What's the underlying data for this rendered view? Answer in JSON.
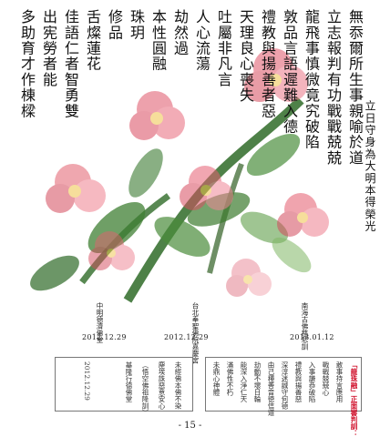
{
  "columns": [
    "無忝爾所生事親喻於道",
    "立志報判有功戰戰兢兢",
    "龍飛事慎微竟究破陷",
    "敦品言語遲難入德",
    "禮教與揚善者惡",
    "天理良心喪失",
    "吐屬非凡言",
    "人心流蕩",
    "劫然過",
    "本性圓融",
    "珠玥",
    "修品",
    "舌燦蓮花"
  ],
  "columns_full": [
    "立日守身為大明本得榮光",
    "多助育才作棟樑",
    "出宪勞者能",
    "佳語仁者智勇雙"
  ],
  "signatures": [
    {
      "text": "南海古佛慈悲訓",
      "date": "2013.01.12"
    },
    {
      "text": "台北奉聖佛院嘉慶宮",
      "date": "2012.12.29"
    },
    {
      "text": "中明德濟佛堂",
      "date": "2012.12.29"
    }
  ],
  "box_right": {
    "heading": "「龍珠融」正面審判訓：",
    "lines": [
      "敢事持言應用",
      "戰戰兢兢心",
      "入事謙恭破陷",
      "禮教與揚善惡",
      "深淳迷誠守何德",
      "由己種善音徳信道",
      "劫動不壞日輪",
      "能深入淨仁天",
      "滿佛性不朽",
      "未鼎心神體"
    ]
  },
  "box_left": {
    "lines": [
      "未經佛本佛不染",
      "塵埃誅惡意安心",
      "（悟空佛祖降訓）",
      "基隆行德佛堂"
    ],
    "date": "2012.12.29"
  },
  "page_number": "- 15 -",
  "colors": {
    "red": "#d0102b",
    "text": "#111111"
  }
}
